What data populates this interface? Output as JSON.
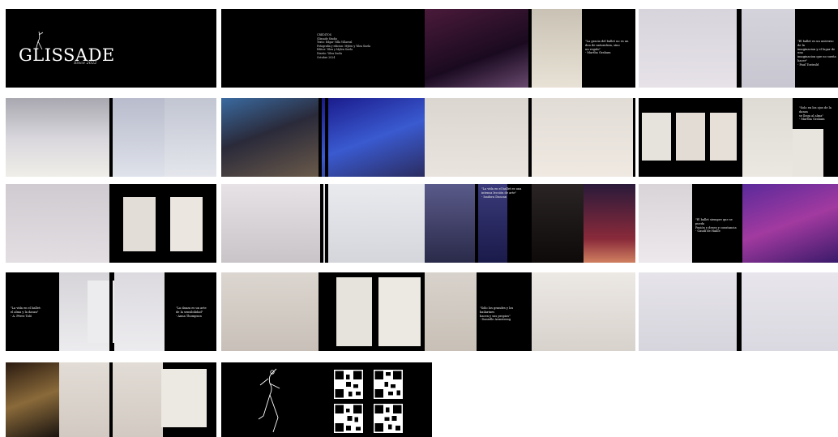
{
  "cover": {
    "title": "GLISSADE",
    "subtitle": "Since 2022"
  },
  "credits_lines": [
    "CREDITOS",
    "Glissade Studio",
    "Texto: Edgar Villa Villareal",
    "Fotografia y edicion: Mylen y Yilea Suela",
    "Editor: Yilea y Mylen Suela",
    "Diseño: Yilea Suela",
    "Octubre 2024"
  ],
  "quotes": {
    "q1": [
      "\"La gracia del ballet no es un",
      "don de naturaleza, sino",
      "un regalo\"",
      "- Martha Graham"
    ],
    "q2": [
      "\"El ballet es un universo de la",
      "imaginacion y el lugar de una",
      "imaginacion que no sueña",
      "hacer\"",
      "- Paul Tostrald"
    ],
    "q3": [
      "\"Solo en los ojos de la danza",
      "se llega al alma\"",
      "- Martha Graham"
    ],
    "q4": [
      "\"La vida en el ballet es una",
      "intensa lección de arte\"",
      "- Isadora Duncan"
    ],
    "q5": [
      "\"El ballet siempre que se pueda",
      "Pasión y deseo y constancia\"",
      "- Gaudí de Haille"
    ],
    "q6": [
      "\"La vida en el ballet:",
      "el alma y la danza\"",
      "- A. Pérez Toló"
    ],
    "q7": [
      "\"La danza es un arte",
      "de la sensibilidad\"",
      "- Anna Thompson"
    ],
    "q8": [
      "\"Sólo los grandes y los bailarines",
      "hacen y sus propios\"",
      "- Danielle Armstrong"
    ]
  },
  "colors": {
    "background": "#ffffff",
    "spread_black": "#000000"
  }
}
